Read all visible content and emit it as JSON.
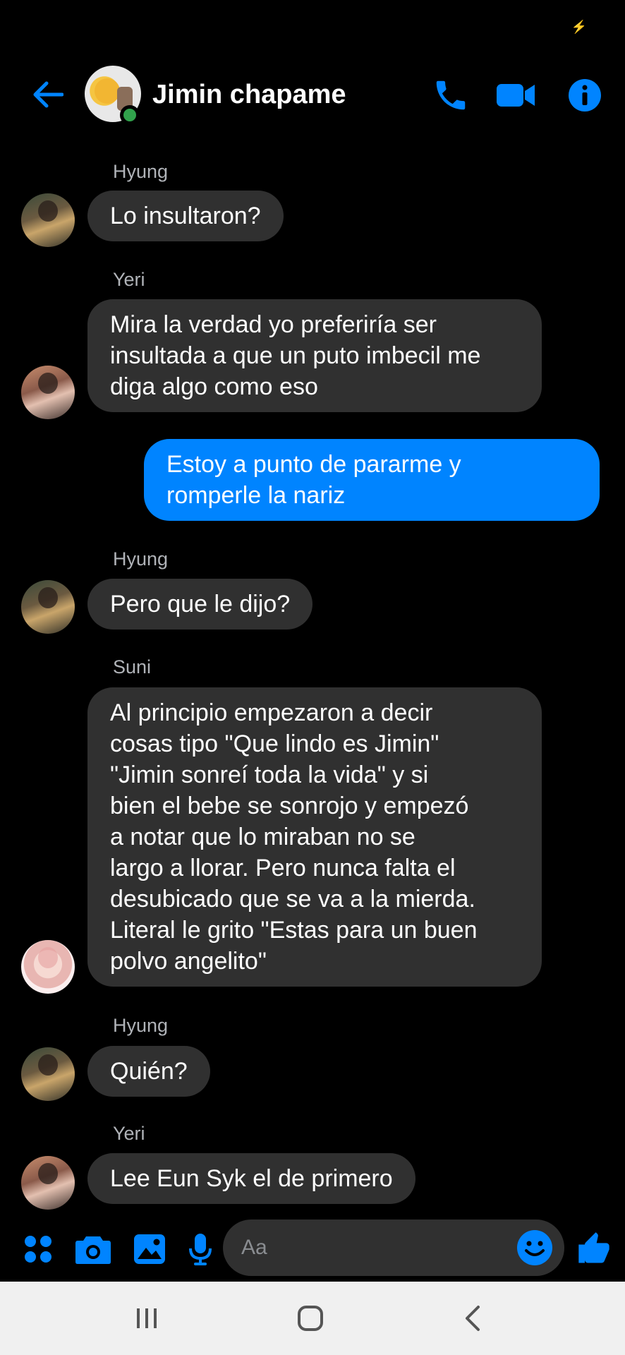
{
  "header": {
    "title": "Jimin chapame",
    "back_icon": "arrow-left-icon",
    "call_icon": "phone-icon",
    "video_icon": "video-camera-icon",
    "info_icon": "info-icon",
    "accent_color": "#0084ff",
    "online_color": "#31a24c"
  },
  "messages": [
    {
      "sender": "Hyung",
      "text": "Lo insultaron?"
    },
    {
      "sender": "Yeri",
      "text": "Mira la verdad yo preferiría ser\ninsultada a que un puto imbecil me\ndiga algo como eso"
    },
    {
      "sender": "",
      "text": "Estoy a punto de pararme y\nromperle la nariz"
    },
    {
      "sender": "Hyung",
      "text": "Pero que le dijo?"
    },
    {
      "sender": "Suni",
      "text": "Al principio empezaron a decir\ncosas tipo \"Que lindo es Jimin\"\n\"Jimin sonreí toda la vida\" y si\nbien el bebe se sonrojo y empezó\na notar que lo miraban no se\nlargo a llorar. Pero nunca falta el\ndesubicado que se va a la mierda.\nLiteral le grito \"Estas para un buen\npolvo angelito\""
    },
    {
      "sender": "Hyung",
      "text": "Quién?"
    },
    {
      "sender": "Yeri",
      "text": "Lee Eun Syk el de primero"
    }
  ],
  "composer": {
    "placeholder": "Aa",
    "menu_icon": "apps-grid-icon",
    "camera_icon": "camera-icon",
    "gallery_icon": "image-icon",
    "mic_icon": "microphone-icon",
    "emoji_icon": "smiley-icon",
    "like_icon": "thumbs-up-icon"
  },
  "navbar": {
    "recent_icon": "recent-apps-icon",
    "home_icon": "home-icon",
    "back_icon": "back-chevron-icon"
  }
}
